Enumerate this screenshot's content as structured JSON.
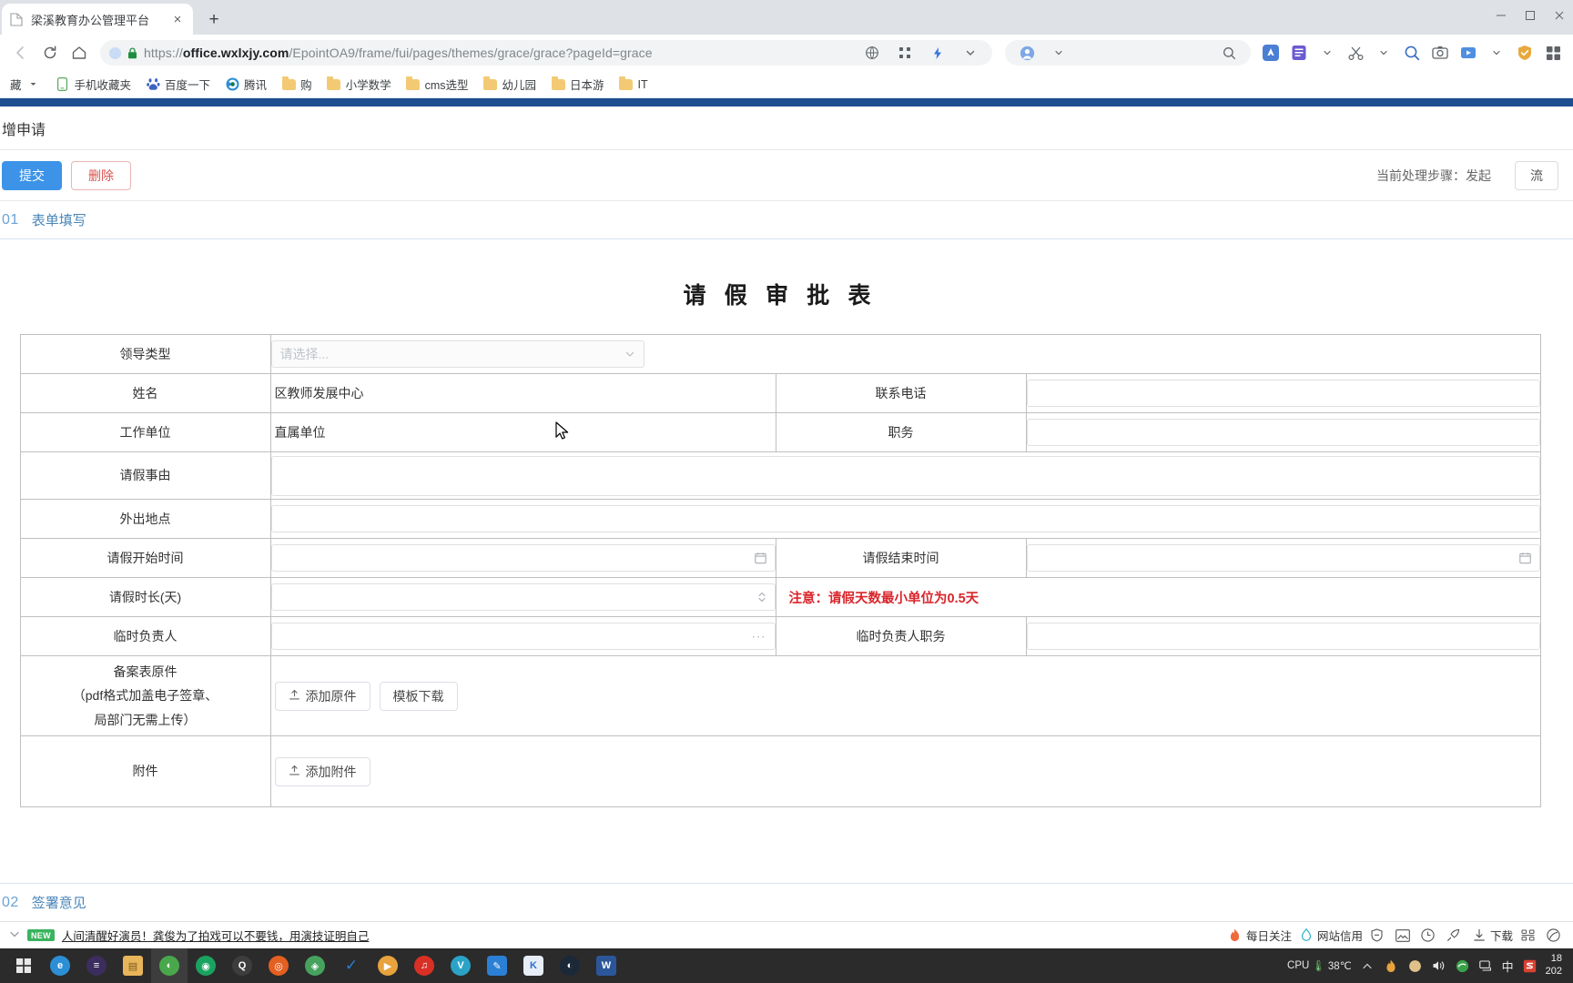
{
  "browser": {
    "tab": {
      "title": "梁溪教育办公管理平台",
      "favicon": "page-icon",
      "close": "×"
    },
    "newtab_label": "+",
    "window_controls": [
      "−",
      "□",
      "×"
    ],
    "nav": {
      "back": "‹",
      "forward": "›",
      "reload": "⟳",
      "home": "⌂",
      "url_scheme": "https://",
      "url_host": "office.wxlxjy.com",
      "url_path": "/EpointOA9/frame/fui/pages/themes/grace/grace?pageId=grace",
      "lock": "lock-icon",
      "search_placeholder": ""
    },
    "bookmarks": [
      {
        "label": "藏",
        "icon": "chevron-down-icon",
        "type": "overflow"
      },
      {
        "label": "手机收藏夹",
        "icon": "phone-icon",
        "type": "link"
      },
      {
        "label": "百度一下",
        "icon": "baidu-icon",
        "type": "link"
      },
      {
        "label": "腾讯",
        "icon": "tencent-icon",
        "type": "link"
      },
      {
        "label": "购",
        "icon": "folder-icon",
        "type": "folder"
      },
      {
        "label": "小学数学",
        "icon": "folder-icon",
        "type": "folder"
      },
      {
        "label": "cms选型",
        "icon": "folder-icon",
        "type": "folder"
      },
      {
        "label": "幼儿园",
        "icon": "folder-icon",
        "type": "folder"
      },
      {
        "label": "日本游",
        "icon": "folder-icon",
        "type": "folder"
      },
      {
        "label": "IT",
        "icon": "folder-icon",
        "type": "folder"
      }
    ]
  },
  "app": {
    "breadcrumb": "增申请",
    "toolbar": {
      "submit_label": "提交",
      "delete_label": "删除",
      "step_status": "当前处理步骤：发起",
      "right_button_label": "流"
    },
    "section_1": {
      "num": "01",
      "label": "表单填写"
    },
    "section_2": {
      "num": "02",
      "label": "签署意见"
    },
    "form": {
      "title": "请 假 审 批 表",
      "rows": {
        "leader_type": {
          "label": "领导类型",
          "placeholder": "请选择...",
          "value": "",
          "suffix_icon": "chevron-down-icon"
        },
        "name": {
          "label": "姓名",
          "value": "区教师发展中心"
        },
        "phone": {
          "label": "联系电话",
          "value": ""
        },
        "work_unit": {
          "label": "工作单位",
          "value": "直属单位"
        },
        "position": {
          "label": "职务",
          "value": ""
        },
        "reason": {
          "label": "请假事由",
          "value": ""
        },
        "location": {
          "label": "外出地点",
          "value": ""
        },
        "start_time": {
          "label": "请假开始时间",
          "value": "",
          "suffix_icon": "calendar-icon"
        },
        "end_time": {
          "label": "请假结束时间",
          "value": "",
          "suffix_icon": "calendar-icon"
        },
        "duration": {
          "label": "请假时长(天)",
          "value": "",
          "suffix_icon": "spinner-icon"
        },
        "duration_hint": "注意：请假天数最小单位为0.5天",
        "temp_manager": {
          "label": "临时负责人",
          "value": "",
          "suffix_icon": "ellipsis-icon"
        },
        "temp_manager_position": {
          "label": "临时负责人职务",
          "value": ""
        },
        "record_file": {
          "label_line1": "备案表原件",
          "label_line2": "（pdf格式加盖电子签章、",
          "label_line3": "局部门无需上传）",
          "add_label": "添加原件",
          "template_label": "模板下载",
          "upload_icon": "upload-icon"
        },
        "attachment": {
          "label": "附件",
          "add_label": "添加附件",
          "upload_icon": "upload-icon"
        }
      }
    }
  },
  "news_bar": {
    "chevron": "chevron-down-icon",
    "badge": "NEW",
    "headline": "人间清醒好演员！龚俊为了拍戏可以不要钱，用演技证明自己",
    "items": [
      {
        "label": "每日关注",
        "icon": "flame-icon"
      },
      {
        "label": "网站信用",
        "icon": "droplet-icon"
      },
      {
        "label": "",
        "icon": "shield-icon"
      },
      {
        "label": "",
        "icon": "image-icon"
      },
      {
        "label": "",
        "icon": "gauge-icon"
      },
      {
        "label": "",
        "icon": "rocket-icon"
      },
      {
        "label": "下载",
        "icon": "download-icon"
      },
      {
        "label": "",
        "icon": "qr-icon"
      },
      {
        "label": "",
        "icon": "leaf-icon"
      }
    ]
  },
  "taskbar": {
    "start_icon": "windows-start-icon",
    "apps": [
      {
        "name": "edge-icon",
        "color": "#2c8fd6",
        "glyph": "e"
      },
      {
        "name": "uc-browser-icon",
        "color": "#3b2d5e",
        "glyph": "≡"
      },
      {
        "name": "file-explorer-icon",
        "color": "#e8b55a",
        "glyph": "▤"
      },
      {
        "name": "sogou-browser-icon",
        "color": "#49a84c",
        "glyph": "◐",
        "active": true
      },
      {
        "name": "chrome-icon",
        "color": "#1aa260",
        "glyph": "◉"
      },
      {
        "name": "qq-icon",
        "color": "#3d3d3d",
        "glyph": "Q"
      },
      {
        "name": "firefox-icon",
        "color": "#e35f22",
        "glyph": "◎"
      },
      {
        "name": "security-icon",
        "color": "#46a35e",
        "glyph": "◈"
      },
      {
        "name": "todo-icon",
        "color": "#2b7fd4",
        "glyph": "✓"
      },
      {
        "name": "media-player-icon",
        "color": "#e8a33d",
        "glyph": "▶"
      },
      {
        "name": "music-icon",
        "color": "#d93025",
        "glyph": "♫"
      },
      {
        "name": "wps-icon",
        "color": "#2ba3c7",
        "glyph": "V"
      },
      {
        "name": "notes-icon",
        "color": "#2b7fd4",
        "glyph": "✎"
      },
      {
        "name": "kugou-icon",
        "color": "#e8eef7",
        "glyph": "K"
      },
      {
        "name": "steam-icon",
        "color": "#1b2838",
        "glyph": "◐"
      },
      {
        "name": "word-icon",
        "color": "#2b579a",
        "glyph": "W"
      }
    ],
    "tray": {
      "cpu_label": "CPU",
      "cpu_temp": "38℃",
      "chevron": "chevron-up-icon",
      "icons": [
        "flame-icon",
        "shield-icon",
        "volume-icon",
        "edge-tray-icon",
        "network-icon",
        "ime-icon",
        "sogou-icon"
      ],
      "ime_label": "中",
      "time": "18",
      "date": "202"
    }
  }
}
